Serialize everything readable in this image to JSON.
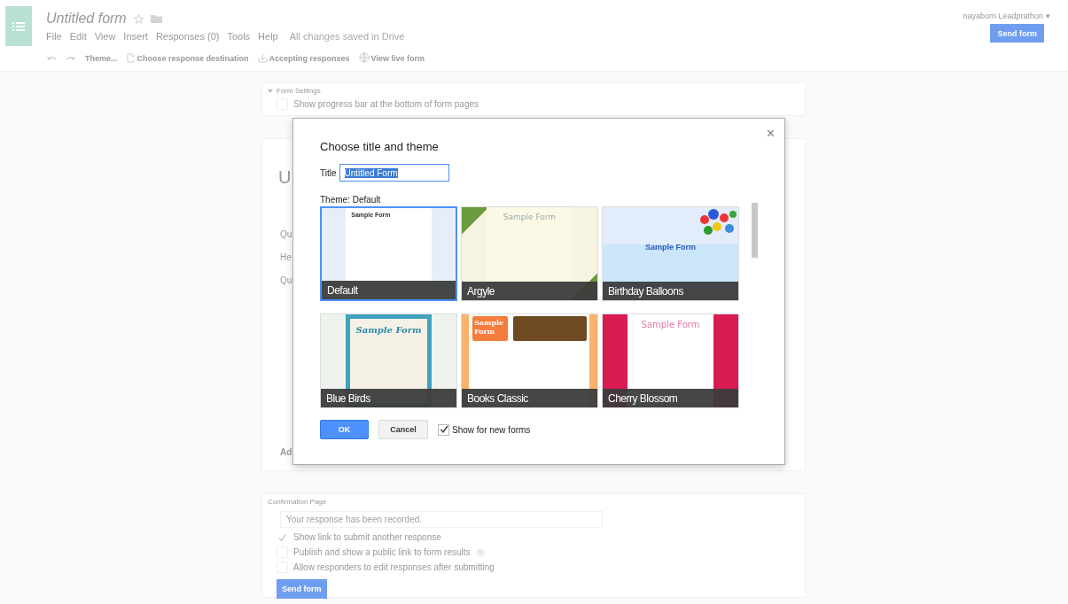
{
  "header": {
    "title": "Untitled form",
    "menu": [
      "File",
      "Edit",
      "View",
      "Insert",
      "Responses (0)",
      "Tools",
      "Help"
    ],
    "save_status": "All changes saved in Drive",
    "user": "nayaborn Leadprathon",
    "user_caret": "▾",
    "send_button": "Send form"
  },
  "toolbar": [
    {
      "kind": "undo"
    },
    {
      "kind": "redo"
    },
    {
      "kind": "text",
      "label": "Theme..."
    },
    {
      "kind": "destination",
      "label": "Choose response destination"
    },
    {
      "kind": "accepting",
      "label": "Accepting responses"
    },
    {
      "kind": "live",
      "label": "View live form"
    }
  ],
  "form_settings": {
    "heading": "Form Settings",
    "options": [
      {
        "label": "Show progress bar at the bottom of form pages",
        "checked": false
      }
    ]
  },
  "page_card": {
    "title_fragment": "U",
    "field_fragments": [
      "Qu",
      "He",
      "Qu"
    ],
    "add_fragment": "Ad"
  },
  "confirmation": {
    "heading": "Confirmation Page",
    "placeholder": "Your response has been recorded.",
    "options": [
      {
        "label": "Show link to submit another response",
        "checked": true,
        "help": false
      },
      {
        "label": "Publish and show a public link to form results",
        "checked": false,
        "help": true
      },
      {
        "label": "Allow responders to edit responses after submitting",
        "checked": false,
        "help": false
      }
    ],
    "send_button": "Send form"
  },
  "dialog": {
    "heading": "Choose title and theme",
    "close": "×",
    "title_label": "Title",
    "title_value": "Untitled Form",
    "theme_label": "Theme: Default",
    "themes": [
      {
        "name": "Default",
        "kind": "plain",
        "preview_title": "Sample Form",
        "selected": true
      },
      {
        "name": "Argyle",
        "kind": "argyle",
        "preview_title": "Sample Form",
        "selected": false
      },
      {
        "name": "Birthday Balloons",
        "kind": "balloons",
        "preview_title": "Sample Form",
        "selected": false
      },
      {
        "name": "Blue Birds",
        "kind": "birds",
        "preview_title": "Sample Form",
        "selected": false
      },
      {
        "name": "Books Classic",
        "kind": "books",
        "preview_title": "Sample\nForm",
        "selected": false
      },
      {
        "name": "Cherry Blossom",
        "kind": "blossom",
        "preview_title": "Sample Form",
        "selected": false
      }
    ],
    "ok": "OK",
    "cancel": "Cancel",
    "show_new": {
      "label": "Show for new forms",
      "checked": true
    }
  }
}
